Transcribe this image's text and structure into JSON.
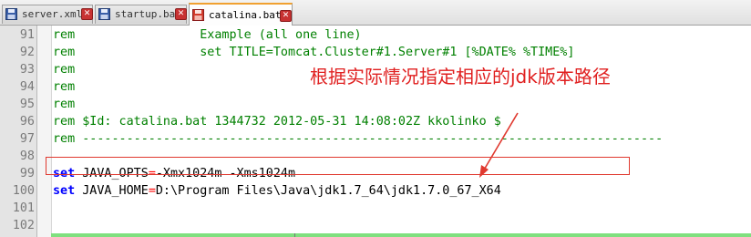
{
  "tabs": [
    {
      "label": "server.xml",
      "active": false
    },
    {
      "label": "startup.bat",
      "active": false
    },
    {
      "label": "catalina.bat",
      "active": true
    }
  ],
  "close_glyph": "✕",
  "lines": [
    {
      "num": "91",
      "kw": "rem",
      "text": "                 Example (all one line)"
    },
    {
      "num": "92",
      "kw": "rem",
      "text": "                 set TITLE=Tomcat.Cluster#1.Server#1 [%DATE% %TIME%]"
    },
    {
      "num": "93",
      "kw": "rem",
      "text": ""
    },
    {
      "num": "94",
      "kw": "rem",
      "text": ""
    },
    {
      "num": "95",
      "kw": "rem",
      "text": ""
    },
    {
      "num": "96",
      "kw": "rem",
      "text": " $Id: catalina.bat 1344732 2012-05-31 14:08:02Z kkolinko $"
    },
    {
      "num": "97",
      "kw": "rem",
      "text": " -------------------------------------------------------------------------------"
    },
    {
      "num": "98",
      "kw": "",
      "text": ""
    },
    {
      "num": "99",
      "kw": "set",
      "name": " JAVA_OPTS",
      "op": "=",
      "value": "-Xmx1024m -Xms1024m"
    },
    {
      "num": "100",
      "kw": "set",
      "name": " JAVA_HOME",
      "op": "=",
      "value": "D:\\Program Files\\Java\\jdk1.7_64\\jdk1.7.0_67_X64"
    },
    {
      "num": "101",
      "kw": "",
      "text": ""
    },
    {
      "num": "102",
      "kw": "",
      "text": ""
    }
  ],
  "annotation": "根据实际情况指定相应的jdk版本路径",
  "colors": {
    "rem": "#008000",
    "set": "#0000ff",
    "operator": "#ff0000",
    "annotation": "#e02020",
    "highlight_box": "#e0392f"
  }
}
